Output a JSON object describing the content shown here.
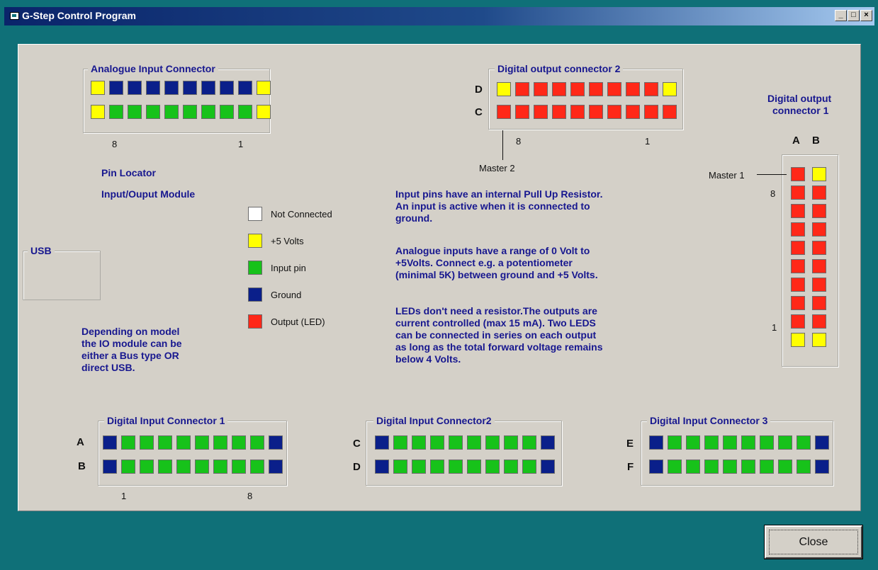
{
  "window": {
    "title": "G-Step Control Program",
    "min_glyph": "_",
    "max_glyph": "□",
    "close_glyph": "×"
  },
  "colors": {
    "yellow": "#ffff00",
    "blue": "#0a1f8a",
    "green": "#17c21a",
    "red": "#ff2818",
    "white": "#ffffff",
    "title_text": "#17178f"
  },
  "analogue": {
    "title": "Analogue Input Connector",
    "row1": [
      "yellow",
      "blue",
      "blue",
      "blue",
      "blue",
      "blue",
      "blue",
      "blue",
      "blue",
      "yellow"
    ],
    "row2": [
      "yellow",
      "green",
      "green",
      "green",
      "green",
      "green",
      "green",
      "green",
      "green",
      "yellow"
    ],
    "left_num": "8",
    "right_num": "1"
  },
  "dout2": {
    "title": "Digital output connector 2",
    "label_d": "D",
    "label_c": "C",
    "row_d": [
      "yellow",
      "red",
      "red",
      "red",
      "red",
      "red",
      "red",
      "red",
      "red",
      "yellow"
    ],
    "row_c": [
      "red",
      "red",
      "red",
      "red",
      "red",
      "red",
      "red",
      "red",
      "red",
      "red"
    ],
    "left_num": "8",
    "right_num": "1",
    "master": "Master 2"
  },
  "dout1": {
    "title_line1": "Digital output",
    "title_line2": "connector 1",
    "label_a": "A",
    "label_b": "B",
    "col_a": [
      "red",
      "red",
      "red",
      "red",
      "red",
      "red",
      "red",
      "red",
      "red",
      "yellow"
    ],
    "col_b": [
      "yellow",
      "red",
      "red",
      "red",
      "red",
      "red",
      "red",
      "red",
      "red",
      "yellow"
    ],
    "master": "Master 1",
    "top_num": "8",
    "bottom_num": "1"
  },
  "pin_locator": {
    "line1": "Pin Locator",
    "line2": "Input/Ouput Module"
  },
  "legend": [
    {
      "color": "white",
      "label": "Not Connected"
    },
    {
      "color": "yellow",
      "label": "+5 Volts"
    },
    {
      "color": "green",
      "label": "Input pin"
    },
    {
      "color": "blue",
      "label": "Ground"
    },
    {
      "color": "red",
      "label": "Output (LED)"
    }
  ],
  "usb": {
    "title": "USB"
  },
  "notes": {
    "model": "Depending on model\nthe IO module can be\neither a Bus type OR\ndirect USB.",
    "pullup": "Input pins have an internal Pull Up Resistor.\nAn input  is active when it is connected to\nground.",
    "analogue_range": "Analogue inputs have a range of 0 Volt to\n+5Volts. Connect e.g. a potentiometer\n(minimal 5K) between ground and +5 Volts.",
    "leds": "LEDs don't need a resistor.The outputs are\ncurrent controlled (max 15 mA). Two LEDS\ncan be connected in series on each output\nas long as the total forward voltage remains\nbelow 4 Volts."
  },
  "din1": {
    "title": "Digital Input Connector 1",
    "label_top": "A",
    "label_bottom": "B",
    "row_top": [
      "blue",
      "green",
      "green",
      "green",
      "green",
      "green",
      "green",
      "green",
      "green",
      "blue"
    ],
    "row_bottom": [
      "blue",
      "green",
      "green",
      "green",
      "green",
      "green",
      "green",
      "green",
      "green",
      "blue"
    ],
    "left_num": "1",
    "right_num": "8"
  },
  "din2": {
    "title": "Digital Input Connector2",
    "label_top": "C",
    "label_bottom": "D",
    "row_top": [
      "blue",
      "green",
      "green",
      "green",
      "green",
      "green",
      "green",
      "green",
      "green",
      "blue"
    ],
    "row_bottom": [
      "blue",
      "green",
      "green",
      "green",
      "green",
      "green",
      "green",
      "green",
      "green",
      "blue"
    ]
  },
  "din3": {
    "title": "Digital Input Connector 3",
    "label_top": "E",
    "label_bottom": "F",
    "row_top": [
      "blue",
      "green",
      "green",
      "green",
      "green",
      "green",
      "green",
      "green",
      "green",
      "blue"
    ],
    "row_bottom": [
      "blue",
      "green",
      "green",
      "green",
      "green",
      "green",
      "green",
      "green",
      "green",
      "blue"
    ]
  },
  "close_button": {
    "label": "Close"
  }
}
